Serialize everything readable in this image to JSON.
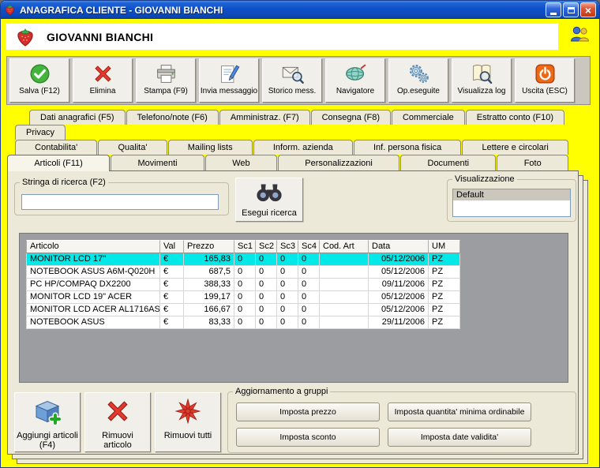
{
  "window": {
    "title": "ANAGRAFICA CLIENTE - GIOVANNI BIANCHI",
    "app_icon": "strawberry-icon"
  },
  "header": {
    "client_name": "GIOVANNI BIANCHI",
    "banner_icon": "strawberry-icon",
    "corner_icon": "users-icon"
  },
  "toolbar": {
    "buttons": [
      {
        "label": "Salva (F12)",
        "icon": "save-check-icon"
      },
      {
        "label": "Elimina",
        "icon": "delete-cross-icon"
      },
      {
        "label": "Stampa (F9)",
        "icon": "printer-icon"
      },
      {
        "label": "Invia messaggio",
        "icon": "compose-message-icon"
      },
      {
        "label": "Storico mess.",
        "icon": "message-history-icon"
      },
      {
        "label": "Navigatore",
        "icon": "navigator-globe-icon"
      },
      {
        "label": "Op.eseguite",
        "icon": "gears-icon"
      },
      {
        "label": "Visualizza log",
        "icon": "log-book-icon"
      },
      {
        "label": "Uscita (ESC)",
        "icon": "power-exit-icon"
      }
    ]
  },
  "tabs": {
    "rows": [
      [
        "Dati anagrafici (F5)",
        "Telefono/note (F6)",
        "Amministraz. (F7)",
        "Consegna (F8)",
        "Commerciale",
        "Estratto conto (F10)"
      ],
      [
        "Privacy"
      ],
      [
        "Contabilita'",
        "Qualita'",
        "Mailing lists",
        "Inform. azienda",
        "Inf. persona fisica",
        "Lettere e circolari"
      ],
      [
        "Articoli (F11)",
        "Movimenti",
        "Web",
        "Personalizzazioni",
        "Documenti",
        "Foto"
      ]
    ],
    "active": "Articoli (F11)"
  },
  "search": {
    "group_label": "Stringa di ricerca (F2)",
    "value": "",
    "button_label": "Esegui ricerca",
    "button_icon": "binoculars-icon"
  },
  "visualization": {
    "group_label": "Visualizzazione",
    "selected_item": "Default"
  },
  "articles_table": {
    "columns": [
      "Articolo",
      "Val",
      "Prezzo",
      "Sc1",
      "Sc2",
      "Sc3",
      "Sc4",
      "Cod. Art",
      "Data",
      "UM"
    ],
    "rows": [
      [
        "MONITOR LCD 17''",
        "€",
        "165,83",
        "0",
        "0",
        "0",
        "0",
        "",
        "05/12/2006",
        "PZ"
      ],
      [
        "NOTEBOOK ASUS A6M-Q020H",
        "€",
        "687,5",
        "0",
        "0",
        "0",
        "0",
        "",
        "05/12/2006",
        "PZ"
      ],
      [
        "PC HP/COMPAQ DX2200",
        "€",
        "388,33",
        "0",
        "0",
        "0",
        "0",
        "",
        "09/11/2006",
        "PZ"
      ],
      [
        "MONITOR LCD 19\" ACER",
        "€",
        "199,17",
        "0",
        "0",
        "0",
        "0",
        "",
        "05/12/2006",
        "PZ"
      ],
      [
        "MONITOR LCD ACER AL1716AS",
        "€",
        "166,67",
        "0",
        "0",
        "0",
        "0",
        "",
        "05/12/2006",
        "PZ"
      ],
      [
        "NOTEBOOK ASUS",
        "€",
        "83,33",
        "0",
        "0",
        "0",
        "0",
        "",
        "29/11/2006",
        "PZ"
      ]
    ],
    "selected_row_index": 0
  },
  "actions": {
    "buttons": [
      {
        "label": "Aggiungi articoli (F4)",
        "icon": "add-box-icon"
      },
      {
        "label": "Rimuovi articolo",
        "icon": "remove-cross-icon"
      },
      {
        "label": "Rimuovi tutti",
        "icon": "remove-all-burst-icon"
      }
    ]
  },
  "group_update": {
    "label": "Aggiornamento a gruppi",
    "buttons": [
      "Imposta prezzo",
      "Imposta quantita' minima ordinabile",
      "Imposta sconto",
      "Imposta date validita'"
    ]
  },
  "colors": {
    "frame_yellow": "#FFFF00",
    "panel_tan": "#ECE9D8",
    "selected_row_cyan": "#00E8E8",
    "titlebar_blue": "#0F50C8",
    "grid_background_gray": "#9C9DA1"
  }
}
